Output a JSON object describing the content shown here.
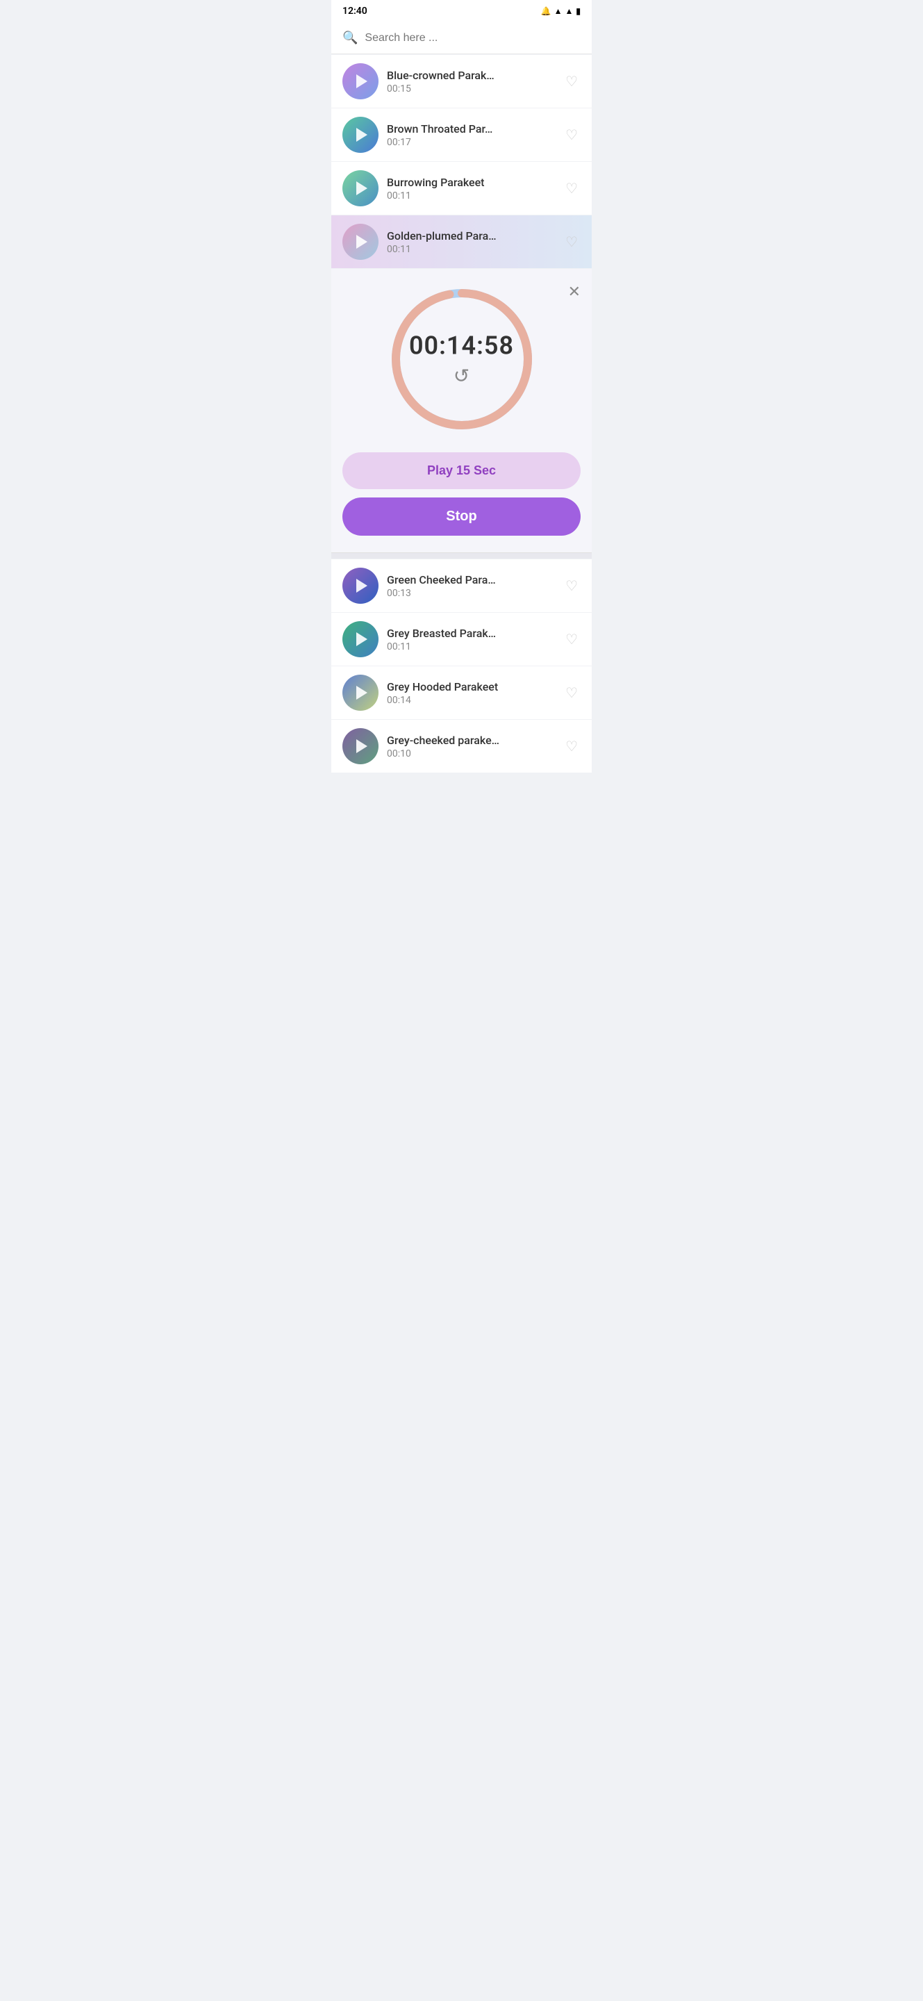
{
  "statusBar": {
    "time": "12:40",
    "icons": [
      "wifi",
      "signal",
      "battery"
    ]
  },
  "search": {
    "placeholder": "Search here ..."
  },
  "listItems": [
    {
      "id": 1,
      "title": "Blue-crowned Parak…",
      "duration": "00:15",
      "avatarClass": "avatar-1",
      "active": false
    },
    {
      "id": 2,
      "title": "Brown Throated Par…",
      "duration": "00:17",
      "avatarClass": "avatar-2",
      "active": false
    },
    {
      "id": 3,
      "title": "Burrowing Parakeet",
      "duration": "00:11",
      "avatarClass": "avatar-3",
      "active": false
    },
    {
      "id": 4,
      "title": "Golden-plumed Para…",
      "duration": "00:11",
      "avatarClass": "avatar-4",
      "active": true
    }
  ],
  "player": {
    "time": "00:14:58",
    "play15Label": "Play 15 Sec",
    "stopLabel": "Stop",
    "progressPercent": 97
  },
  "lowerListItems": [
    {
      "id": 5,
      "title": "Green Cheeked Para…",
      "duration": "00:13",
      "avatarClass": "avatar-5"
    },
    {
      "id": 6,
      "title": "Grey Breasted Parak…",
      "duration": "00:11",
      "avatarClass": "avatar-6"
    },
    {
      "id": 7,
      "title": "Grey Hooded Parakeet",
      "duration": "00:14",
      "avatarClass": "avatar-7"
    },
    {
      "id": 8,
      "title": "Grey-cheeked parake…",
      "duration": "00:10",
      "avatarClass": "avatar-8"
    }
  ]
}
